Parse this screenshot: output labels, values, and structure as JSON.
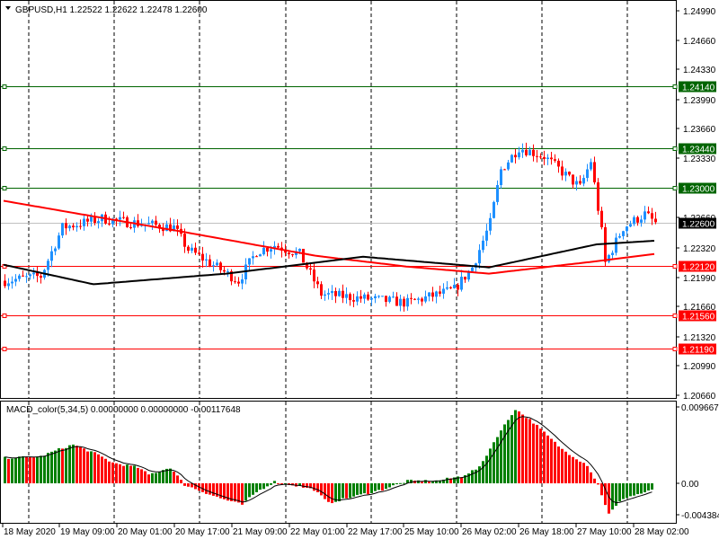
{
  "header": {
    "symbol_info": "GBPUSD,H1  1.22522 1.22622 1.22478 1.22600"
  },
  "macd": {
    "label": "MACD_color(5,34,5) 0.00000000 0.00000000 -0.00117648",
    "axis_labels": [
      "0.0096677",
      "0.00",
      "-0.004384"
    ]
  },
  "price_axis": [
    "1.24990",
    "1.24660",
    "1.24330",
    "1.23990",
    "1.23660",
    "1.23330",
    "1.22660",
    "1.22320",
    "1.21990",
    "1.21660",
    "1.21320",
    "1.20990",
    "1.20660"
  ],
  "levels": [
    {
      "price": "1.24140",
      "color": "#006400"
    },
    {
      "price": "1.23440",
      "color": "#006400"
    },
    {
      "price": "1.23000",
      "color": "#006400"
    },
    {
      "price": "1.22120",
      "color": "#ff0000"
    },
    {
      "price": "1.21560",
      "color": "#ff0000"
    },
    {
      "price": "1.21190",
      "color": "#ff0000"
    }
  ],
  "current_price": "1.22600",
  "time_axis": [
    "18 May 2020",
    "19 May 09:00",
    "20 May 01:00",
    "20 May 17:00",
    "21 May 09:00",
    "22 May 01:00",
    "22 May 17:00",
    "25 May 10:00",
    "26 May 02:00",
    "26 May 18:00",
    "27 May 10:00",
    "28 May 02:00"
  ],
  "colors": {
    "bull": "#1e90ff",
    "bear": "#ff0000",
    "macd_up": "#008000",
    "macd_down": "#ff0000",
    "ma_fast": "#ff0000",
    "ma_slow": "#000000"
  },
  "chart_data": {
    "type": "candlestick",
    "title": "GBPUSD,H1",
    "ylim": [
      1.2066,
      1.2499
    ],
    "close_anchors": [
      [
        0,
        1.2195
      ],
      [
        10,
        1.22
      ],
      [
        16,
        1.2255
      ],
      [
        27,
        1.2265
      ],
      [
        32,
        1.2262
      ],
      [
        47,
        1.2255
      ],
      [
        51,
        1.223
      ],
      [
        57,
        1.2215
      ],
      [
        65,
        1.2195
      ],
      [
        70,
        1.2228
      ],
      [
        75,
        1.2235
      ],
      [
        82,
        1.2225
      ],
      [
        88,
        1.218
      ],
      [
        100,
        1.2175
      ],
      [
        112,
        1.217
      ],
      [
        125,
        1.2185
      ],
      [
        130,
        1.221
      ],
      [
        135,
        1.226
      ],
      [
        138,
        1.232
      ],
      [
        143,
        1.2345
      ],
      [
        150,
        1.2335
      ],
      [
        160,
        1.23
      ],
      [
        163,
        1.233
      ],
      [
        166,
        1.225
      ],
      [
        167,
        1.2215
      ],
      [
        172,
        1.2255
      ],
      [
        178,
        1.227
      ],
      [
        181,
        1.226
      ]
    ],
    "ma_fast": [
      [
        0,
        1.2285
      ],
      [
        50,
        1.225
      ],
      [
        87,
        1.2223
      ],
      [
        112,
        1.2211
      ],
      [
        135,
        1.2203
      ],
      [
        165,
        1.2217
      ],
      [
        181,
        1.2225
      ]
    ],
    "ma_slow": [
      [
        0,
        1.2213
      ],
      [
        25,
        1.2191
      ],
      [
        62,
        1.2203
      ],
      [
        100,
        1.2222
      ],
      [
        135,
        1.221
      ],
      [
        165,
        1.2236
      ],
      [
        181,
        1.224
      ]
    ],
    "macd_ylim": [
      -0.004384,
      0.0096677
    ],
    "macd_anchors": [
      [
        0,
        0.0032
      ],
      [
        10,
        0.0034
      ],
      [
        15,
        0.0043
      ],
      [
        19,
        0.0049
      ],
      [
        25,
        0.0038
      ],
      [
        30,
        0.0026
      ],
      [
        37,
        0.002
      ],
      [
        40,
        0.0011
      ],
      [
        46,
        0.002
      ],
      [
        50,
        -0.0002
      ],
      [
        60,
        -0.0019
      ],
      [
        66,
        -0.0027
      ],
      [
        70,
        -0.0011
      ],
      [
        75,
        0.0002
      ],
      [
        80,
        -0.0002
      ],
      [
        86,
        -0.0008
      ],
      [
        90,
        -0.0025
      ],
      [
        95,
        -0.0019
      ],
      [
        105,
        -0.0008
      ],
      [
        112,
        0.0003
      ],
      [
        120,
        0.0003
      ],
      [
        127,
        0.0009
      ],
      [
        132,
        0.002
      ],
      [
        137,
        0.006
      ],
      [
        142,
        0.0094
      ],
      [
        147,
        0.0077
      ],
      [
        155,
        0.0043
      ],
      [
        162,
        0.0023
      ],
      [
        165,
        -0.0002
      ],
      [
        168,
        -0.0039
      ],
      [
        172,
        -0.0019
      ],
      [
        180,
        -0.0009
      ]
    ]
  }
}
